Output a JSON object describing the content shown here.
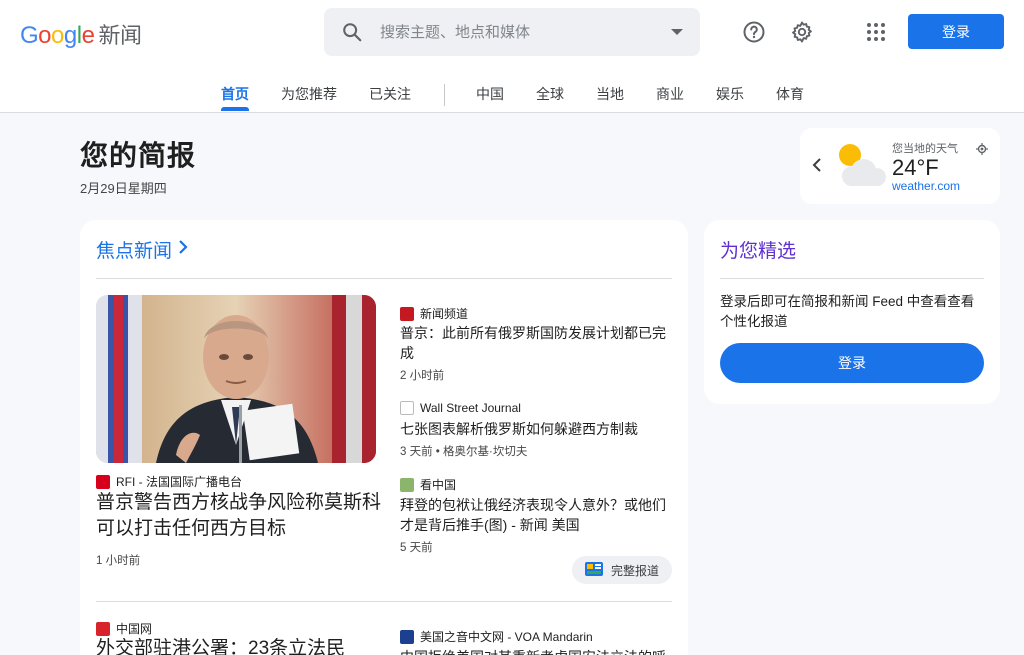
{
  "header": {
    "logo_letters": [
      "G",
      "o",
      "o",
      "g",
      "l",
      "e"
    ],
    "product": "新闻",
    "search_placeholder": "搜索主题、地点和媒体",
    "signin_label": "登录"
  },
  "nav": {
    "tabs": [
      {
        "label": "首页",
        "active": true
      },
      {
        "label": "为您推荐"
      },
      {
        "label": "已关注"
      },
      {
        "label": "中国"
      },
      {
        "label": "全球"
      },
      {
        "label": "当地"
      },
      {
        "label": "商业"
      },
      {
        "label": "娱乐"
      },
      {
        "label": "体育"
      }
    ]
  },
  "briefing": {
    "title": "您的简报",
    "date": "2月29日星期四"
  },
  "weather": {
    "label": "您当地的天气",
    "temp": "24°F",
    "source": "weather.com"
  },
  "headlines": {
    "section_title": "焦点新闻",
    "lead": {
      "source": "RFI - 法国国际广播电台",
      "headline": "普京警告西方核战争风险称莫斯科可以打击任何西方目标",
      "time": "1 小时前"
    },
    "related": [
      {
        "source": "新闻频道",
        "headline": "普京：此前所有俄罗斯国防发展计划都已完成",
        "time": "2 小时前"
      },
      {
        "source": "Wall Street Journal",
        "headline": "七张图表解析俄罗斯如何躲避西方制裁",
        "time": "3 天前 • 格奥尔基·坎切夫"
      },
      {
        "source": "看中国",
        "headline": "拜登的包袱让俄经济表现令人意外？或他们才是背后推手(图) - 新闻 美国",
        "time": "5 天前"
      }
    ],
    "full_coverage": "完整报道",
    "second": {
      "source": "中国网",
      "headline": "外交部驻港公署：23条立法民",
      "related_source": "美国之音中文网 - VOA Mandarin",
      "related_headline": "中国拒绝美国对其重新考虑国安法立法的呼"
    }
  },
  "picks": {
    "title": "为您精选",
    "text": "登录后即可在简报和新闻 Feed 中查看查看个性化报道",
    "button": "登录"
  },
  "colors": {
    "accent": "#1a73e8",
    "picks_title": "#6030d0"
  }
}
